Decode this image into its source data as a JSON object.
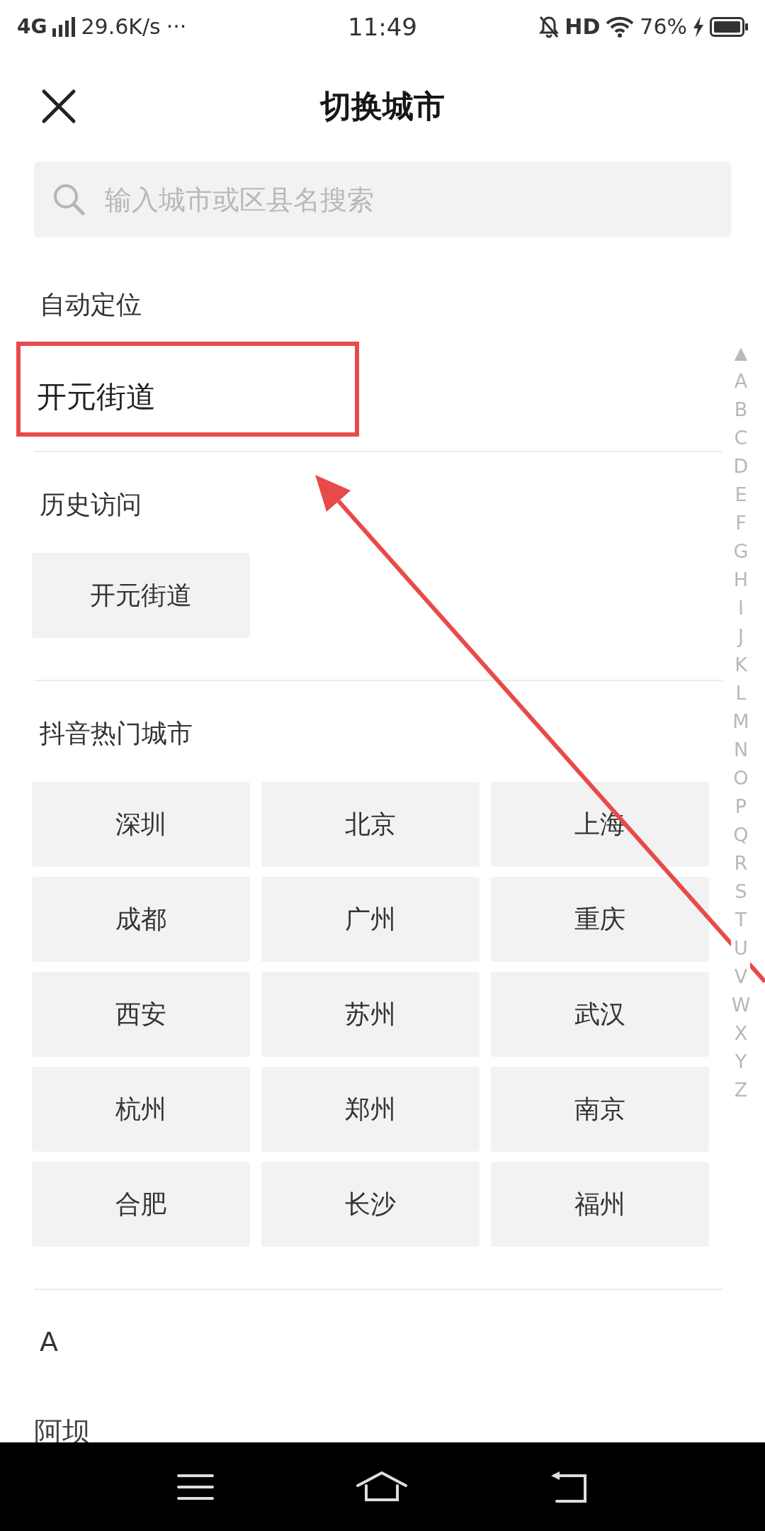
{
  "status_bar": {
    "network": "4G",
    "speed": "29.6K/s",
    "more": "···",
    "time": "11:49",
    "hd": "HD",
    "battery": "76%"
  },
  "header": {
    "title": "切换城市"
  },
  "search": {
    "placeholder": "输入城市或区县名搜索"
  },
  "sections": [
    {
      "kind": "location",
      "heading": "自动定位",
      "items": [
        "开元街道"
      ]
    },
    {
      "kind": "chips",
      "heading": "历史访问",
      "items": [
        "开元街道"
      ]
    },
    {
      "kind": "chips",
      "heading": "抖音热门城市",
      "items": [
        "深圳",
        "北京",
        "上海",
        "成都",
        "广州",
        "重庆",
        "西安",
        "苏州",
        "武汉",
        "杭州",
        "郑州",
        "南京",
        "合肥",
        "长沙",
        "福州"
      ]
    },
    {
      "kind": "letter",
      "heading": "A",
      "items": [
        "阿坝"
      ]
    }
  ],
  "index": {
    "top": "▲",
    "letters": [
      "A",
      "B",
      "C",
      "D",
      "E",
      "F",
      "G",
      "H",
      "I",
      "J",
      "K",
      "L",
      "M",
      "N",
      "O",
      "P",
      "Q",
      "R",
      "S",
      "T",
      "U",
      "V",
      "W",
      "X",
      "Y",
      "Z"
    ]
  }
}
